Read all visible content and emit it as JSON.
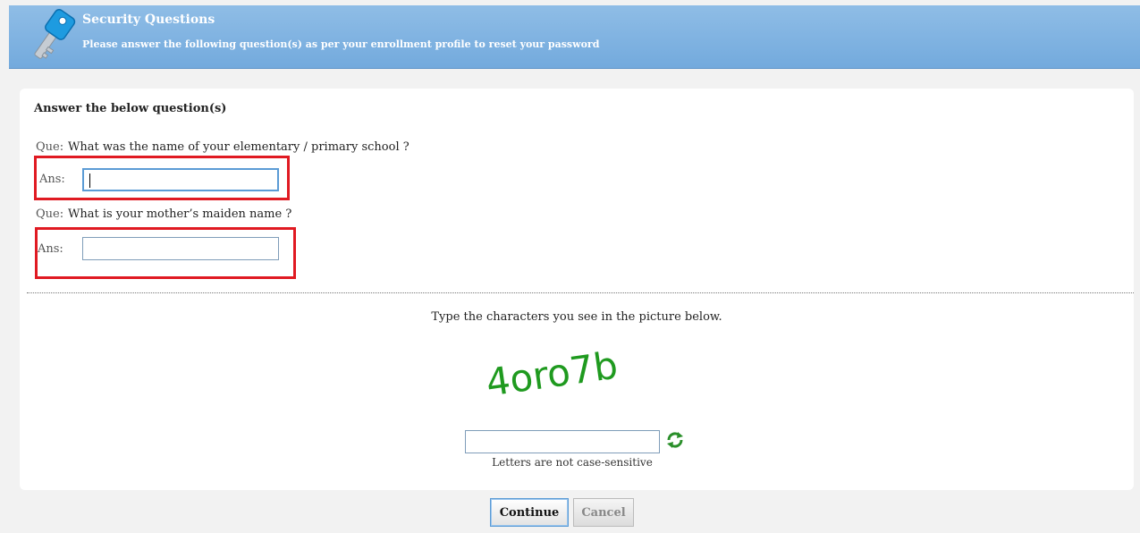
{
  "header": {
    "title": "Security Questions",
    "subtitle": "Please answer the following question(s) as per your enrollment profile to reset your password",
    "icon": "key-icon"
  },
  "form": {
    "section_title": "Answer the below question(s)",
    "questions": [
      {
        "que_label": "Que:",
        "text": "What was the name of your elementary / primary school ?",
        "ans_label": "Ans:",
        "value": ""
      },
      {
        "que_label": "Que:",
        "text": "What is your mother’s maiden name ?",
        "ans_label": "Ans:",
        "value": ""
      }
    ]
  },
  "captcha": {
    "instruction": "Type the characters you see in the picture below.",
    "image_text": "4oro7b",
    "input_value": "",
    "note": "Letters are not case-sensitive",
    "refresh_icon": "refresh-icon"
  },
  "buttons": {
    "continue": "Continue",
    "cancel": "Cancel"
  },
  "colors": {
    "header": "#7fb2e0",
    "highlight": "#e01a22",
    "captcha": "#1f9a1f"
  }
}
